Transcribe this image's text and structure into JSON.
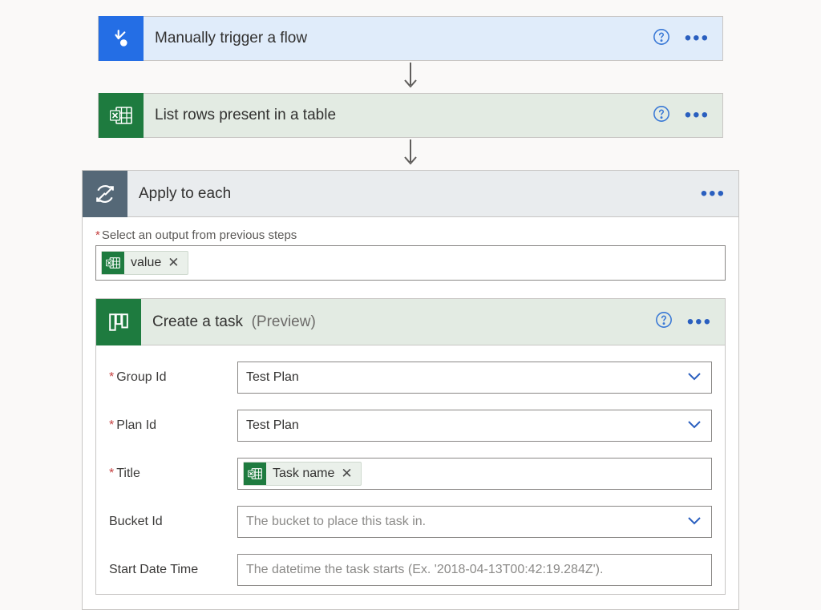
{
  "steps": {
    "trigger": {
      "title": "Manually trigger a flow"
    },
    "listrows": {
      "title": "List rows present in a table"
    },
    "apply": {
      "title": "Apply to each",
      "output_label": "Select an output from previous steps",
      "token": {
        "text": "value"
      }
    },
    "task": {
      "title": "Create a task",
      "suffix": "(Preview)",
      "fields": {
        "group": {
          "label": "Group Id",
          "value": "Test Plan"
        },
        "plan": {
          "label": "Plan Id",
          "value": "Test Plan"
        },
        "title": {
          "label": "Title",
          "token": "Task name"
        },
        "bucket": {
          "label": "Bucket Id",
          "placeholder": "The bucket to place this task in."
        },
        "start": {
          "label": "Start Date Time",
          "placeholder": "The datetime the task starts (Ex. '2018-04-13T00:42:19.284Z')."
        }
      }
    }
  }
}
